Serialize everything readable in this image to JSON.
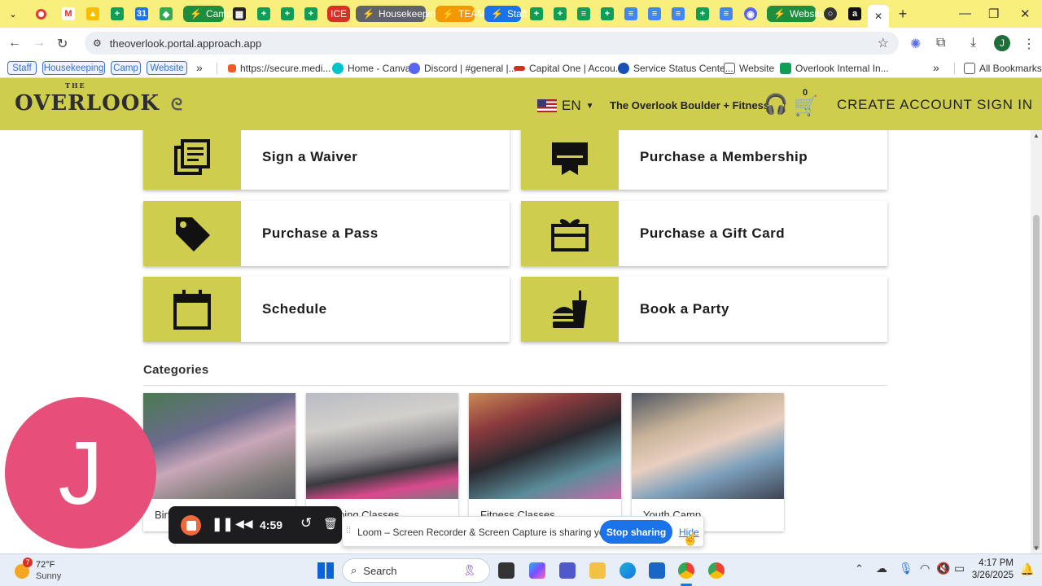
{
  "browser": {
    "group_tabs": [
      {
        "label": "Camp",
        "color": "#1e8e3e"
      },
      {
        "label": "Housekeeping",
        "color": "#5f6368"
      },
      {
        "label": "ICE",
        "color": "#d93025"
      },
      {
        "label": "TEAM",
        "color": "#f29900"
      },
      {
        "label": "Staff",
        "color": "#1a73e8"
      },
      {
        "label": "Website",
        "color": "#1e8e3e"
      }
    ],
    "active_tab_close": "✕",
    "new_tab": "+",
    "url": "theoverlook.portal.approach.app",
    "bookmark_chips": [
      "Staff",
      "Housekeeping",
      "Camp",
      "Website"
    ],
    "bookmarks": [
      "https://secure.medi...",
      "Home - Canva",
      "Discord | #general |...",
      "Capital One | Accou...",
      "Service Status Cente...",
      "Website",
      "Overlook Internal In..."
    ],
    "more": "»",
    "all_bookmarks": "All Bookmarks",
    "profile_initial": "J"
  },
  "site": {
    "logo_top": "THE",
    "logo": "OVERLOOK",
    "language": "EN",
    "location": "The Overlook Boulder + Fitness",
    "cart_count": "0",
    "create_account": "CREATE ACCOUNT",
    "sign_in": "SIGN IN",
    "cards": [
      {
        "label": "Sign a Waiver",
        "icon": "waiver-icon"
      },
      {
        "label": "Purchase a Membership",
        "icon": "membership-card-icon"
      },
      {
        "label": "Purchase a Pass",
        "icon": "tag-icon"
      },
      {
        "label": "Purchase a Gift Card",
        "icon": "gift-icon"
      },
      {
        "label": "Schedule",
        "icon": "calendar-icon"
      },
      {
        "label": "Book a Party",
        "icon": "party-food-icon"
      }
    ],
    "categories_title": "Categories",
    "categories": [
      "Birth",
      "Climbing Classes",
      "Fitness Classes",
      "Youth Camp"
    ]
  },
  "loom": {
    "avatar_initial": "J",
    "timer": "4:59",
    "share_message": "Loom – Screen Recorder & Screen Capture is sharing your screen.",
    "stop_sharing": "Stop sharing",
    "hide": "Hide"
  },
  "taskbar": {
    "weather_temp": "72°F",
    "weather_desc": "Sunny",
    "weather_badge": "7",
    "search": "Search",
    "time": "4:17 PM",
    "date": "3/26/2025"
  }
}
